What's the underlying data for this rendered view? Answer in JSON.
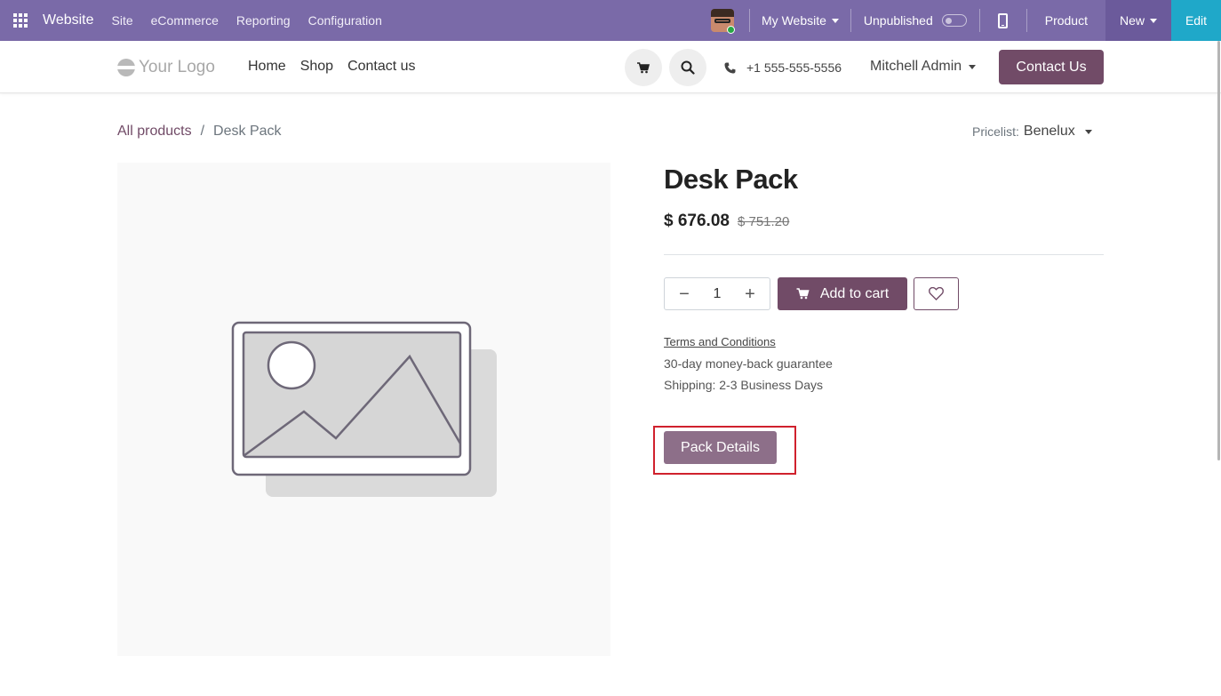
{
  "admin_bar": {
    "app_name": "Website",
    "menus": [
      "Site",
      "eCommerce",
      "Reporting",
      "Configuration"
    ],
    "website_selector": "My Website",
    "publish_status": "Unpublished",
    "product_label": "Product",
    "new_label": "New",
    "edit_label": "Edit",
    "color": "#7a6aa8",
    "edit_color": "#1fa8c9"
  },
  "site_header": {
    "logo_text": "Your Logo",
    "nav": [
      "Home",
      "Shop",
      "Contact us"
    ],
    "phone": "+1 555-555-5556",
    "user": "Mitchell Admin",
    "contact_button": "Contact Us",
    "brand_color": "#714b67"
  },
  "breadcrumb": {
    "root": "All products",
    "separator": "/",
    "current": "Desk Pack"
  },
  "pricelist": {
    "label": "Pricelist:",
    "value": "Benelux"
  },
  "product": {
    "name": "Desk Pack",
    "price": "$ 676.08",
    "old_price": "$ 751.20",
    "quantity": "1",
    "add_to_cart": "Add to cart",
    "terms": "Terms and Conditions",
    "guarantee": "30-day money-back guarantee",
    "shipping": "Shipping: 2-3 Business Days",
    "pack_details": "Pack Details"
  },
  "icons": [
    "apps-icon",
    "mobile-preview-icon",
    "cart-icon",
    "search-icon",
    "phone-icon",
    "heart-icon",
    "image-placeholder-icon"
  ]
}
